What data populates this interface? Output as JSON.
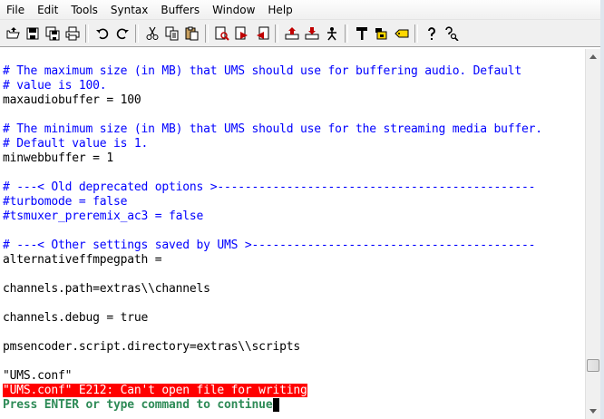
{
  "menu": [
    "File",
    "Edit",
    "Tools",
    "Syntax",
    "Buffers",
    "Window",
    "Help"
  ],
  "toolbar": {
    "groups": [
      [
        "open-icon",
        "save-icon",
        "save-all-icon",
        "print-icon"
      ],
      [
        "undo-icon",
        "redo-icon"
      ],
      [
        "cut-icon",
        "copy-icon",
        "paste-icon"
      ],
      [
        "find-icon",
        "find-next-icon",
        "find-prev-icon"
      ],
      [
        "load-session-icon",
        "save-session-icon",
        "run-script-icon"
      ],
      [
        "make-icon",
        "shell-icon",
        "tag-icon"
      ],
      [
        "help-icon",
        "find-help-icon"
      ]
    ]
  },
  "colors": {
    "comment": "#0000ff",
    "text": "#000000",
    "error_bg": "#ff0000",
    "more_prompt": "#2e8b57"
  },
  "editor": {
    "lines": [
      {
        "text": "# The maximum size (in MB) that UMS should use for buffering audio. Default",
        "kind": "comment"
      },
      {
        "text": "# value is 100.",
        "kind": "comment"
      },
      {
        "text": "maxaudiobuffer = 100",
        "kind": "normal"
      },
      {
        "text": "",
        "kind": "normal"
      },
      {
        "text": "# The minimum size (in MB) that UMS should use for the streaming media buffer.",
        "kind": "comment"
      },
      {
        "text": "# Default value is 1.",
        "kind": "comment"
      },
      {
        "text": "minwebbuffer = 1",
        "kind": "normal"
      },
      {
        "text": "",
        "kind": "normal"
      },
      {
        "text": "# ---< Old deprecated options >----------------------------------------------",
        "kind": "comment"
      },
      {
        "text": "#turbomode = false",
        "kind": "comment"
      },
      {
        "text": "#tsmuxer_preremix_ac3 = false",
        "kind": "comment"
      },
      {
        "text": "",
        "kind": "normal"
      },
      {
        "text": "# ---< Other settings saved by UMS >-----------------------------------------",
        "kind": "comment"
      },
      {
        "text": "alternativeffmpegpath =",
        "kind": "normal"
      },
      {
        "text": "",
        "kind": "normal"
      },
      {
        "text": "channels.path=extras\\\\channels",
        "kind": "normal"
      },
      {
        "text": "",
        "kind": "normal"
      },
      {
        "text": "channels.debug = true",
        "kind": "normal"
      },
      {
        "text": "",
        "kind": "normal"
      },
      {
        "text": "pmsencoder.script.directory=extras\\\\scripts",
        "kind": "normal"
      },
      {
        "text": "",
        "kind": "normal"
      },
      {
        "text": "\"UMS.conf\"",
        "kind": "normal"
      },
      {
        "text": "\"UMS.conf\" E212: Can't open file for writing",
        "kind": "error"
      },
      {
        "text": "Press ENTER or type command to continue",
        "kind": "more"
      }
    ]
  }
}
